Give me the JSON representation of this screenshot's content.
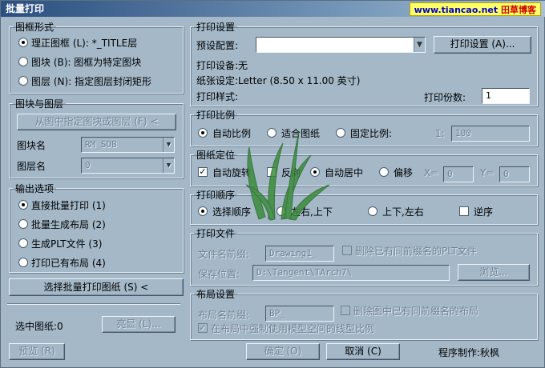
{
  "window": {
    "title": "批量打印",
    "watermark_site": "www.tiancao.net",
    "watermark_name": "田草博客"
  },
  "frame_form": {
    "legend": "图框形式",
    "opt1": "理正图框 (L): *_TITLE层",
    "opt2": "图块 (B): 图框为特定图块",
    "opt3": "图层 (N): 指定图层封闭矩形",
    "selected": "opt1"
  },
  "block_layer": {
    "legend": "图块与图层",
    "pick_button": "从图中指定图块或图层 (F) <",
    "block_label": "图块名",
    "block_value": "RM_SDB",
    "layer_label": "图层名",
    "layer_value": "0"
  },
  "output": {
    "legend": "输出选项",
    "opt1": "直接批量打印 (1)",
    "opt2": "批量生成布局 (2)",
    "opt3": "生成PLT文件 (3)",
    "opt4": "打印已有布局 (4)",
    "selected": "opt1"
  },
  "select_button": "选择批量打印图纸 (S) <",
  "selected_label": "选中图纸:0",
  "highlight_button": "亮显 (L)...",
  "preview_button": "预览 (R)",
  "print_settings": {
    "legend": "打印设置",
    "preset_label": "预设配置:",
    "preset_value": "",
    "settings_button": "打印设置 (A)...",
    "device": "打印设备:无",
    "paper": "纸张设定:Letter (8.50 x 11.00 英寸)",
    "style": "打印样式:",
    "copies_label": "打印份数:",
    "copies_value": "1"
  },
  "scale": {
    "legend": "打印比例",
    "auto": "自动比例",
    "fit": "适合图纸",
    "fixed": "固定比例:",
    "ratio_prefix": "1:",
    "ratio_value": "100",
    "selected": "auto"
  },
  "position": {
    "legend": "图纸定位",
    "auto_rotate": "自动旋转",
    "auto_rotate_checked": true,
    "reverse": "反向",
    "reverse_checked": false,
    "auto_center": "自动居中",
    "offset": "偏移",
    "selected": "auto_center",
    "x_label": "X=",
    "x_value": "0",
    "y_label": "Y=",
    "y_value": "0"
  },
  "order": {
    "legend": "打印顺序",
    "select_order": "选择顺序",
    "lr_tb": "左右,上下",
    "tb_lr": "上下,左右",
    "selected": "select_order",
    "reverse": "逆序",
    "reverse_checked": false
  },
  "print_file": {
    "legend": "打印文件",
    "prefix_label": "文件名前缀:",
    "prefix_value": "Drawing1_",
    "delete_label": "删除已有同前缀名的PLT文件",
    "save_label": "保存位置:",
    "save_value": "D:\\Tangent\\TArch7\\",
    "browse_button": "浏览..."
  },
  "layout": {
    "legend": "布局设置",
    "prefix_label": "布局名前缀:",
    "prefix_value": "BP_",
    "delete_label": "删除图中已有同前缀名的布局",
    "force_label": "在布局中强制使用模型空间的线型比例",
    "force_checked": true
  },
  "footer": {
    "ok": "确定 (O)",
    "cancel": "取消 (C)",
    "credit": "程序制作:秋枫"
  },
  "colors": {
    "face": "#a4b8c8",
    "titlebar": "#2a4f7f",
    "watermark_bg": "#ffff66",
    "logo": "#3a8c3a"
  },
  "icons": {
    "logo": "grass-logo-watermark",
    "combo": "dropdown-arrow-icon"
  }
}
